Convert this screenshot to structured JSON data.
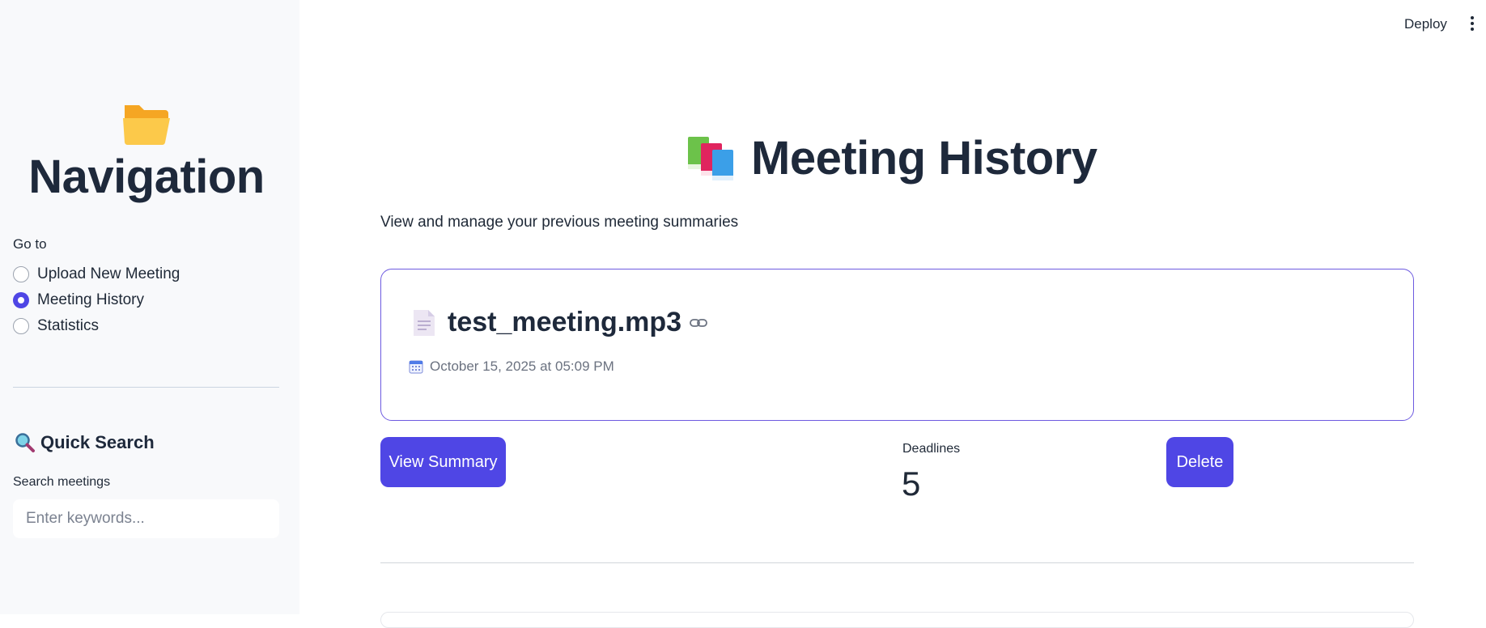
{
  "sidebar": {
    "icon": "open-folder-icon",
    "title": "Navigation",
    "goto_label": "Go to",
    "options": [
      {
        "label": "Upload New Meeting",
        "selected": false
      },
      {
        "label": "Meeting History",
        "selected": true
      },
      {
        "label": "Statistics",
        "selected": false
      }
    ],
    "quick_search": {
      "icon": "magnifier-icon",
      "title": "Quick Search",
      "label": "Search meetings",
      "placeholder": "Enter keywords...",
      "value": ""
    }
  },
  "header": {
    "deploy_label": "Deploy",
    "menu_icon": "kebab-menu-icon"
  },
  "main": {
    "title_icon": "books-icon",
    "title": "Meeting History",
    "subtitle": "View and manage your previous meeting summaries",
    "meetings": [
      {
        "file_icon": "document-icon",
        "file_name": "test_meeting.mp3",
        "date_icon": "calendar-icon",
        "date": "October 15, 2025 at 05:09 PM",
        "view_label": "View Summary",
        "metric_label": "Deadlines",
        "metric_value": "5",
        "delete_label": "Delete"
      }
    ]
  },
  "colors": {
    "accent": "#4f46e5",
    "card_border": "#6d5ae0",
    "sidebar_bg": "#f8f9fb"
  }
}
